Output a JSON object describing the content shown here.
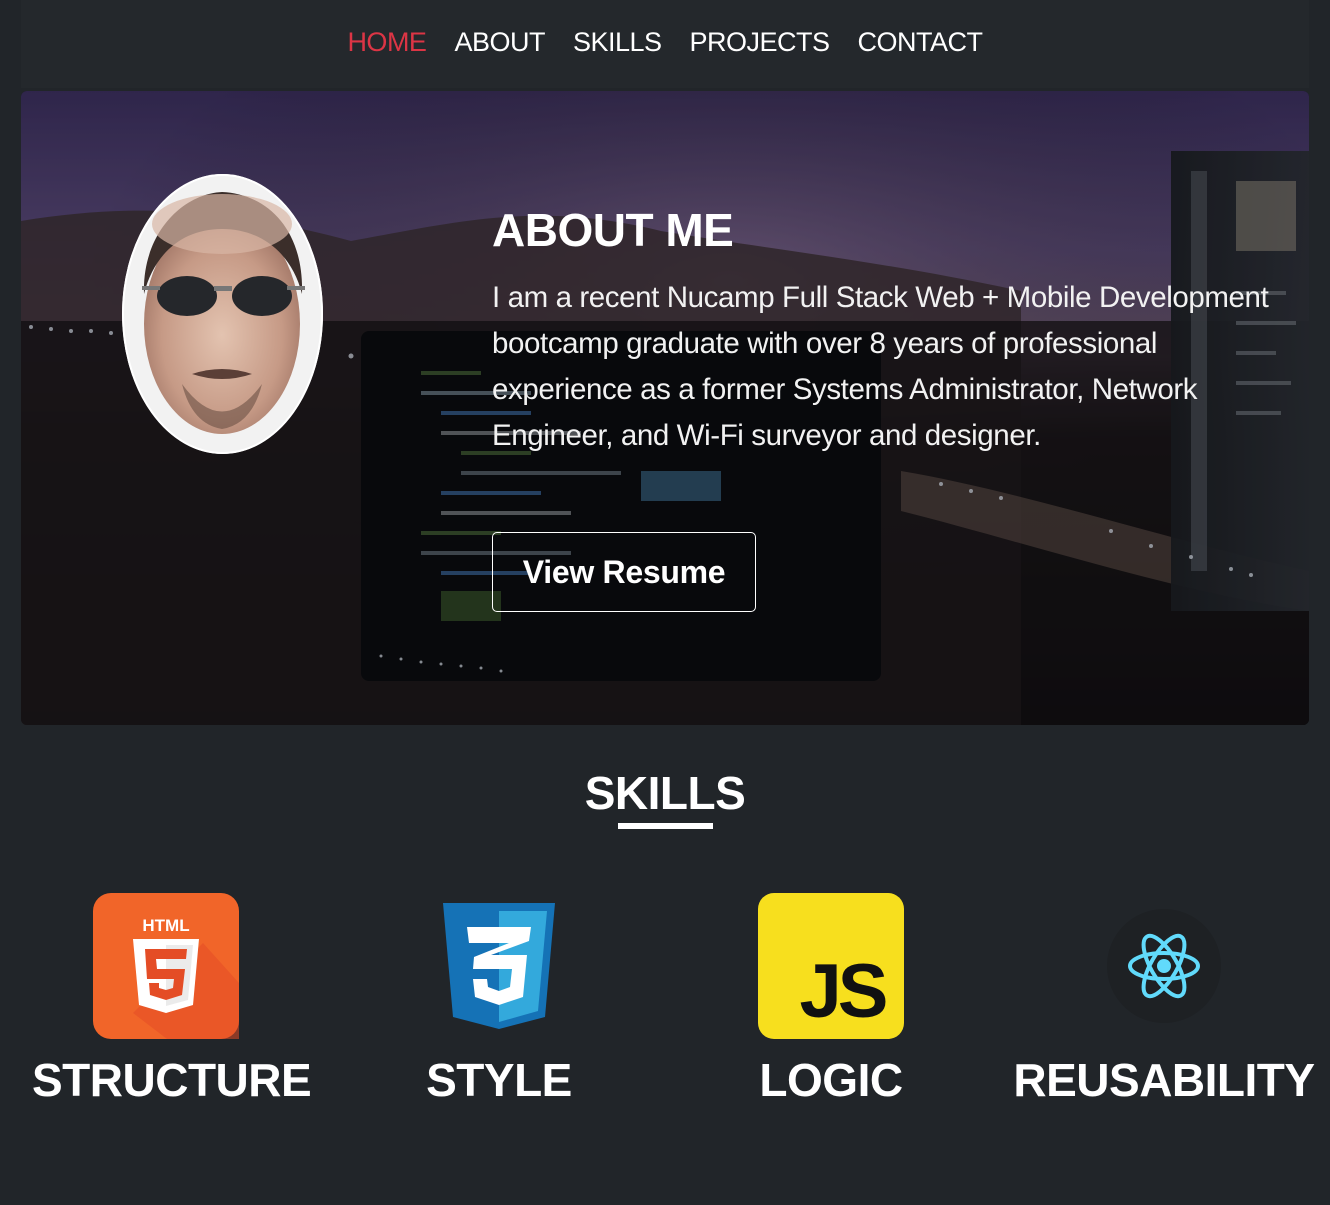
{
  "nav": {
    "items": [
      {
        "label": "HOME",
        "active": true
      },
      {
        "label": "ABOUT",
        "active": false
      },
      {
        "label": "SKILLS",
        "active": false
      },
      {
        "label": "PROJECTS",
        "active": false
      },
      {
        "label": "CONTACT",
        "active": false
      }
    ]
  },
  "hero": {
    "title": "ABOUT ME",
    "body": "I am a recent Nucamp Full Stack Web + Mobile Development bootcamp graduate with over 8 years of professional experience as a former Systems Administrator, Network Engineer, and Wi-Fi surveyor and designer.",
    "button_label": "View Resume"
  },
  "skills": {
    "title": "SKILLS",
    "items": [
      {
        "label": "STRUCTURE",
        "icon": "html5-icon",
        "logo_text": "HTML"
      },
      {
        "label": "STYLE",
        "icon": "css3-icon"
      },
      {
        "label": "LOGIC",
        "icon": "javascript-icon",
        "logo_text": "JS"
      },
      {
        "label": "REUSABILITY",
        "icon": "react-icon"
      }
    ]
  },
  "colors": {
    "background": "#212529",
    "accent": "#dc3545",
    "html5": "#f16529",
    "css3": "#1572b6",
    "js": "#f7df1e",
    "react": "#61dafb"
  }
}
